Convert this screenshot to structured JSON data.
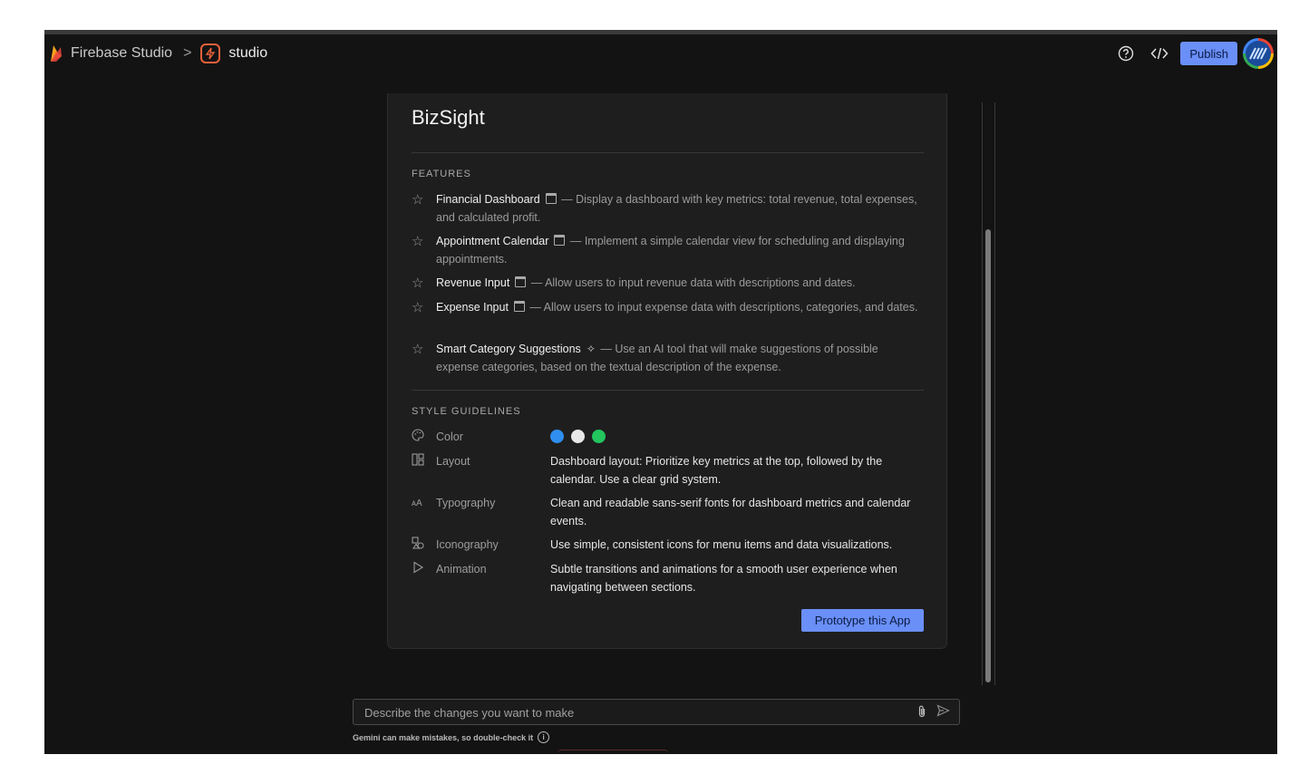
{
  "header": {
    "brand": "Firebase Studio",
    "separator": ">",
    "workspace": "studio",
    "publish_label": "Publish",
    "icons": [
      "help-icon",
      "code-icon"
    ]
  },
  "card": {
    "title": "BizSight",
    "features_label": "FEATURES",
    "features": [
      {
        "name": "Financial Dashboard",
        "icon": "window-icon",
        "desc": " — Display a dashboard with key metrics: total revenue, total expenses, and calculated profit."
      },
      {
        "name": "Appointment Calendar",
        "icon": "window-icon",
        "desc": " — Implement a simple calendar view for scheduling and displaying appointments."
      },
      {
        "name": "Revenue Input",
        "icon": "window-icon",
        "desc": " — Allow users to input revenue data with descriptions and dates."
      },
      {
        "name": "Expense Input",
        "icon": "window-icon",
        "desc": " — Allow users to input expense data with descriptions, categories, and dates."
      },
      {
        "name": "Smart Category Suggestions",
        "icon": "sparkle-icon",
        "desc": " — Use an AI tool that will make suggestions of possible expense categories, based on the textual description of the expense."
      }
    ],
    "style_label": "STYLE GUIDELINES",
    "style": {
      "color_label": "Color",
      "colors": [
        "#2f8ef0",
        "#e8e8e8",
        "#22c55e"
      ],
      "layout_label": "Layout",
      "layout_value": "Dashboard layout: Prioritize key metrics at the top, followed by the calendar. Use a clear grid system.",
      "typography_label": "Typography",
      "typography_value": "Clean and readable sans-serif fonts for dashboard metrics and calendar events.",
      "iconography_label": "Iconography",
      "iconography_value": "Use simple, consistent icons for menu items and data visualizations.",
      "animation_label": "Animation",
      "animation_value": "Subtle transitions and animations for a smooth user experience when navigating between sections."
    },
    "prototype_label": "Prototype this App"
  },
  "chat": {
    "placeholder": "Describe the changes you want to make",
    "disclaimer": "Gemini can make mistakes, so double-check it"
  },
  "colors": {
    "accent": "#6a8ff7",
    "background": "#131313",
    "card": "#1e1e1e"
  }
}
